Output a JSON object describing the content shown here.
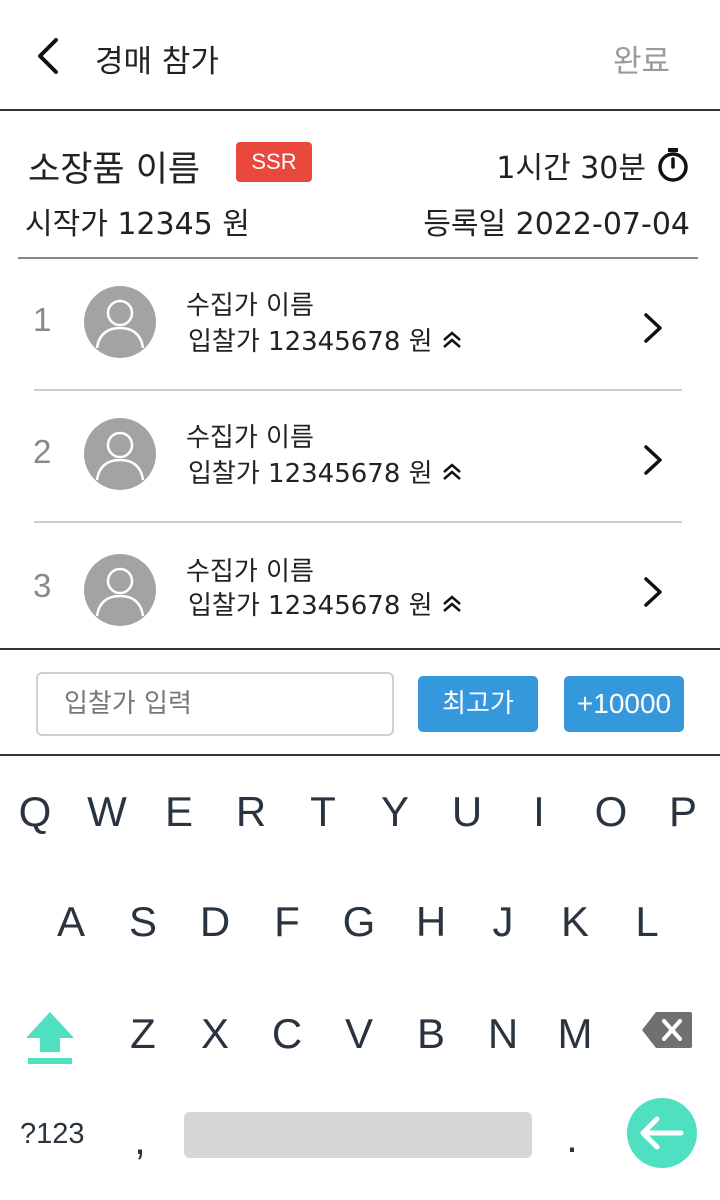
{
  "header": {
    "title": "경매 참가",
    "done_label": "완료"
  },
  "item": {
    "name": "소장품 이름",
    "grade": "SSR",
    "remaining_time": "1시간 30분",
    "start_price": "시작가 12345 원",
    "reg_date": "등록일 2022-07-04"
  },
  "bids": [
    {
      "rank": "1",
      "name": "수집가 이름",
      "price": "입찰가 12345678 원"
    },
    {
      "rank": "2",
      "name": "수집가 이름",
      "price": "입찰가 12345678 원"
    },
    {
      "rank": "3",
      "name": "수집가 이름",
      "price": "입찰가 12345678 원"
    }
  ],
  "input": {
    "placeholder": "입찰가 입력",
    "max_label": "최고가",
    "plus_label": "+10000"
  },
  "keyboard": {
    "row1": [
      "Q",
      "W",
      "E",
      "R",
      "T",
      "Y",
      "U",
      "I",
      "O",
      "P"
    ],
    "row2": [
      "A",
      "S",
      "D",
      "F",
      "G",
      "H",
      "J",
      "K",
      "L"
    ],
    "row3": [
      "Z",
      "X",
      "C",
      "V",
      "B",
      "N",
      "M"
    ],
    "symbols_label": "?123",
    "comma": ",",
    "period": "."
  },
  "colors": {
    "grade_badge": "#e8493c",
    "primary_button": "#3597dc",
    "accent_key": "#4fe0c1"
  }
}
